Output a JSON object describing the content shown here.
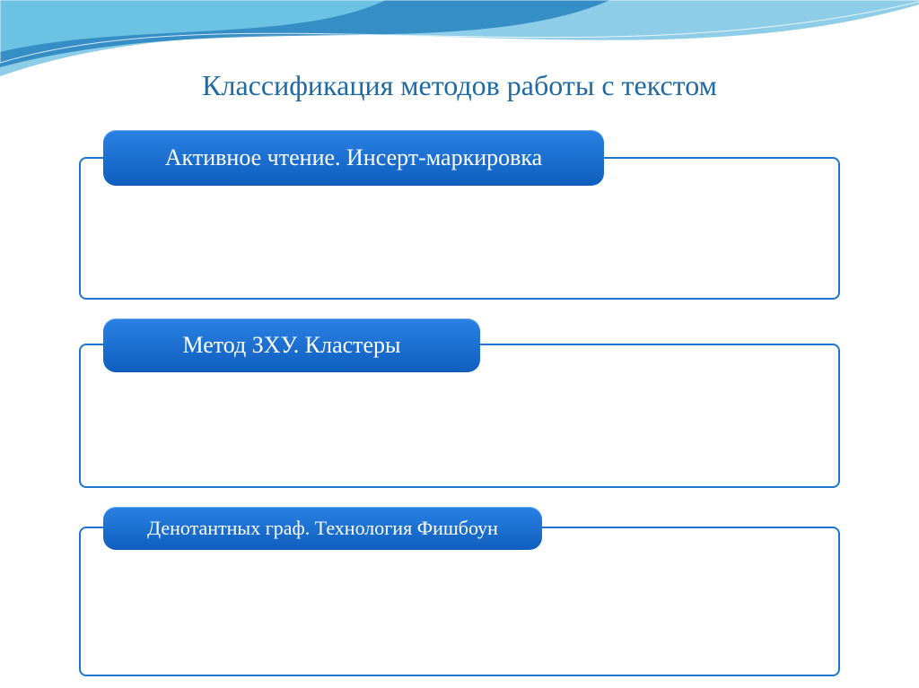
{
  "title": "Классификация методов работы с текстом",
  "blocks": {
    "b1": {
      "header": "Активное чтение.   Инсерт-маркировка"
    },
    "b2": {
      "header": "Метод ЗХУ.    Кластеры"
    },
    "b3": {
      "header": "Денотантных граф.  Технология Фишбоун"
    }
  },
  "colors": {
    "accent": "#1e74cf",
    "title": "#1f6aa5"
  }
}
